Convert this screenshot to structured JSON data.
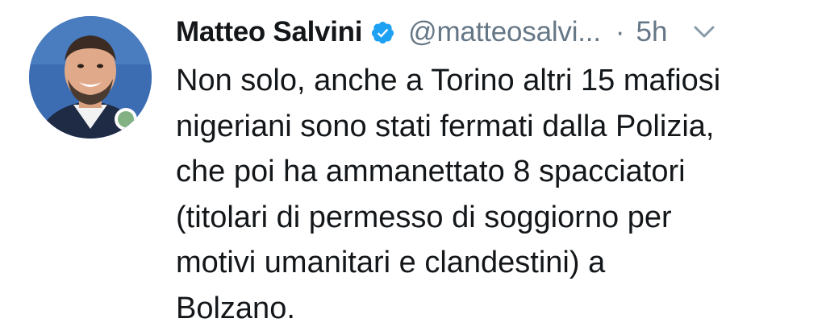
{
  "tweet": {
    "author": {
      "display_name": "Matteo Salvini",
      "handle": "@matteosalvi...",
      "verified": true,
      "avatar": "profile-photo"
    },
    "separator": "·",
    "timestamp": "5h",
    "menu_icon": "chevron-down-icon",
    "text_lines": [
      "Non solo, anche a Torino altri 15 mafiosi",
      "nigeriani sono stati fermati dalla Polizia,",
      "che poi ha ammanettato 8 spacciatori",
      "(titolari di permesso di soggiorno per",
      "motivi umanitari e clandestini) a",
      "Bolzano."
    ]
  },
  "colors": {
    "text_primary": "#14171a",
    "text_secondary": "#657786",
    "verified_blue": "#1da1f2",
    "background": "#ffffff"
  }
}
